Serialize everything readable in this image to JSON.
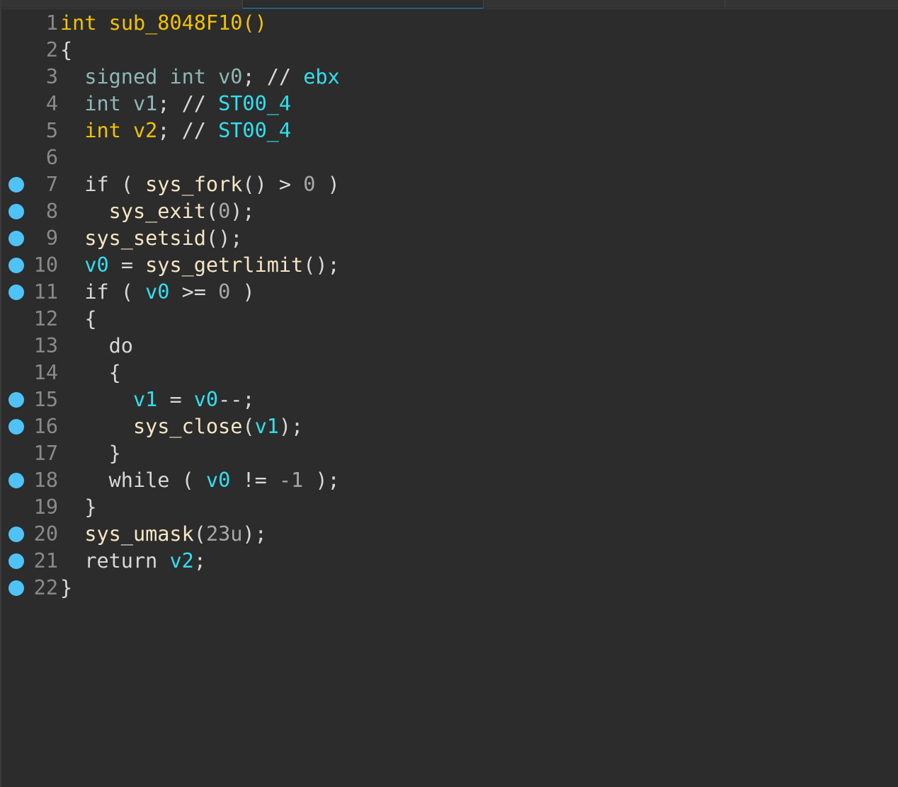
{
  "tabs": [
    "",
    "",
    ""
  ],
  "lines": [
    {
      "n": "1",
      "bp": false,
      "indent": 0,
      "tokens": [
        [
          "int",
          "kwy"
        ],
        [
          " ",
          ""
        ],
        [
          "sub_8048F10",
          "kwy"
        ],
        [
          "()",
          "kwy"
        ]
      ]
    },
    {
      "n": "2",
      "bp": false,
      "indent": 0,
      "tokens": [
        [
          "{",
          "op"
        ]
      ]
    },
    {
      "n": "3",
      "bp": false,
      "indent": 1,
      "tokens": [
        [
          "signed",
          "kw"
        ],
        [
          " ",
          ""
        ],
        [
          "int",
          "kw"
        ],
        [
          " ",
          ""
        ],
        [
          "v0",
          "kw"
        ],
        [
          "; // ",
          "op"
        ],
        [
          "ebx",
          "var"
        ]
      ]
    },
    {
      "n": "4",
      "bp": false,
      "indent": 1,
      "tokens": [
        [
          "int",
          "kw"
        ],
        [
          " ",
          ""
        ],
        [
          "v1",
          "kw"
        ],
        [
          "; // ",
          "op"
        ],
        [
          "ST00_4",
          "var"
        ]
      ]
    },
    {
      "n": "5",
      "bp": false,
      "indent": 1,
      "tokens": [
        [
          "int",
          "kwy"
        ],
        [
          " ",
          ""
        ],
        [
          "v2",
          "kwy"
        ],
        [
          "; // ",
          "op"
        ],
        [
          "ST00_4",
          "var"
        ]
      ]
    },
    {
      "n": "6",
      "bp": false,
      "indent": 0,
      "tokens": []
    },
    {
      "n": "7",
      "bp": true,
      "indent": 1,
      "tokens": [
        [
          "if",
          "op"
        ],
        [
          " ( ",
          "op"
        ],
        [
          "sys_fork",
          "fn"
        ],
        [
          "() > ",
          "op"
        ],
        [
          "0",
          "num"
        ],
        [
          " )",
          "op"
        ]
      ]
    },
    {
      "n": "8",
      "bp": true,
      "indent": 2,
      "tokens": [
        [
          "sys_exit",
          "fn"
        ],
        [
          "(",
          "op"
        ],
        [
          "0",
          "num"
        ],
        [
          ");",
          "op"
        ]
      ]
    },
    {
      "n": "9",
      "bp": true,
      "indent": 1,
      "tokens": [
        [
          "sys_setsid",
          "fn"
        ],
        [
          "();",
          "op"
        ]
      ]
    },
    {
      "n": "10",
      "bp": true,
      "indent": 1,
      "tokens": [
        [
          "v0",
          "var"
        ],
        [
          " = ",
          "op"
        ],
        [
          "sys_getrlimit",
          "fn"
        ],
        [
          "();",
          "op"
        ]
      ]
    },
    {
      "n": "11",
      "bp": true,
      "indent": 1,
      "tokens": [
        [
          "if",
          "op"
        ],
        [
          " ( ",
          "op"
        ],
        [
          "v0",
          "var"
        ],
        [
          " >= ",
          "op"
        ],
        [
          "0",
          "num"
        ],
        [
          " )",
          "op"
        ]
      ]
    },
    {
      "n": "12",
      "bp": false,
      "indent": 1,
      "tokens": [
        [
          "{",
          "op"
        ]
      ]
    },
    {
      "n": "13",
      "bp": false,
      "indent": 2,
      "tokens": [
        [
          "do",
          "op"
        ]
      ]
    },
    {
      "n": "14",
      "bp": false,
      "indent": 2,
      "tokens": [
        [
          "{",
          "op"
        ]
      ]
    },
    {
      "n": "15",
      "bp": true,
      "indent": 3,
      "tokens": [
        [
          "v1",
          "var"
        ],
        [
          " = ",
          "op"
        ],
        [
          "v0",
          "var"
        ],
        [
          "--;",
          "op"
        ]
      ]
    },
    {
      "n": "16",
      "bp": true,
      "indent": 3,
      "tokens": [
        [
          "sys_close",
          "fn"
        ],
        [
          "(",
          "op"
        ],
        [
          "v1",
          "var"
        ],
        [
          ");",
          "op"
        ]
      ]
    },
    {
      "n": "17",
      "bp": false,
      "indent": 2,
      "tokens": [
        [
          "}",
          "op"
        ]
      ]
    },
    {
      "n": "18",
      "bp": true,
      "indent": 2,
      "tokens": [
        [
          "while",
          "op"
        ],
        [
          " ( ",
          "op"
        ],
        [
          "v0",
          "var"
        ],
        [
          " != ",
          "op"
        ],
        [
          "-1",
          "num"
        ],
        [
          " );",
          "op"
        ]
      ]
    },
    {
      "n": "19",
      "bp": false,
      "indent": 1,
      "tokens": [
        [
          "}",
          "op"
        ]
      ]
    },
    {
      "n": "20",
      "bp": true,
      "indent": 1,
      "tokens": [
        [
          "sys_umask",
          "fn"
        ],
        [
          "(",
          "op"
        ],
        [
          "23u",
          "num"
        ],
        [
          ");",
          "op"
        ]
      ]
    },
    {
      "n": "21",
      "bp": true,
      "indent": 1,
      "tokens": [
        [
          "return",
          "op"
        ],
        [
          " ",
          ""
        ],
        [
          "v2",
          "var"
        ],
        [
          ";",
          "op"
        ]
      ]
    },
    {
      "n": "22",
      "bp": true,
      "indent": 0,
      "tokens": [
        [
          "}",
          "op"
        ]
      ]
    }
  ],
  "colors": {
    "background": "#2c2c2c",
    "breakpoint": "#4fc3f7",
    "keyword_yellow": "#f2c200",
    "variable": "#2fe0f0"
  }
}
